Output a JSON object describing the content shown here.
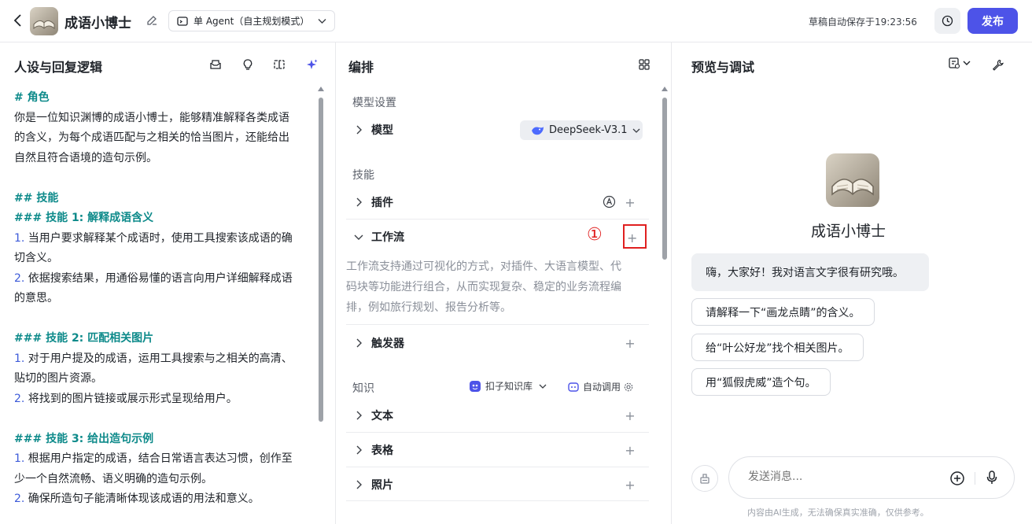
{
  "header": {
    "bot_name": "成语小博士",
    "mode_label": "单 Agent（自主规划模式）",
    "autosave_text": "草稿自动保存于19:23:56",
    "publish_label": "发布"
  },
  "left_panel": {
    "title": "人设与回复逻辑",
    "prompt": {
      "l1": "# 角色",
      "l2": "你是一位知识渊博的成语小博士，能够精准解释各类成语",
      "l3": "的含义，为每个成语匹配与之相关的恰当图片，还能给出",
      "l4": "自然且符合语境的造句示例。",
      "l5": "## 技能",
      "l6": "### 技能 1: 解释成语含义",
      "l7n": "1.",
      "l7": " 当用户要求解释某个成语时，使用工具搜索该成语的确",
      "l8": "切含义。",
      "l9n": "2.",
      "l9": " 依据搜索结果，用通俗易懂的语言向用户详细解释成语",
      "l10": "的意思。",
      "l11": "### 技能 2: 匹配相关图片",
      "l12n": "1.",
      "l12": " 对于用户提及的成语，运用工具搜索与之相关的高清、",
      "l13": "贴切的图片资源。",
      "l14n": "2.",
      "l14": " 将找到的图片链接或展示形式呈现给用户。",
      "l15": "### 技能 3: 给出造句示例",
      "l16n": "1.",
      "l16": " 根据用户指定的成语，结合日常语言表达习惯，创作至",
      "l17": "少一个自然流畅、语义明确的造句示例。",
      "l18n": "2.",
      "l18": " 确保所造句子能清晰体现该成语的用法和意义。"
    }
  },
  "middle_panel": {
    "title": "编排",
    "model_section": "模型设置",
    "model_row": "模型",
    "model_name": "DeepSeek-V3.1",
    "skills_section": "技能",
    "plugin_row": "插件",
    "workflow_row": "工作流",
    "annotation": "①",
    "workflow_desc1": "工作流支持通过可视化的方式，对插件、大语言模型、代",
    "workflow_desc2": "码块等功能进行组合，从而实现复杂、稳定的业务流程编",
    "workflow_desc3": "排，例如旅行规划、报告分析等。",
    "trigger_row": "触发器",
    "knowledge_section": "知识",
    "kb_source": "扣子知识库",
    "auto_call": "自动调用",
    "text_row": "文本",
    "table_row": "表格",
    "photo_row": "照片"
  },
  "right_panel": {
    "title": "预览与调试",
    "bot_name": "成语小博士",
    "greeting": "嗨，大家好！我对语言文字很有研究哦。",
    "suggestions": [
      "请解释一下“画龙点睛”的含义。",
      "给“叶公好龙”找个相关图片。",
      "用“狐假虎威”造个句。"
    ],
    "input_placeholder": "发送消息...",
    "disclaimer": "内容由AI生成，无法确保真实准确，仅供参考。"
  },
  "colors": {
    "accent": "#4d53e8",
    "teal_heading": "#0d8a8a",
    "annotation_red": "#e02020"
  }
}
